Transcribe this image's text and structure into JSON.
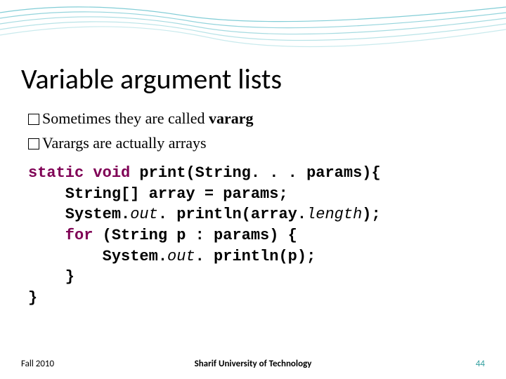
{
  "title": "Variable argument lists",
  "bullets": [
    {
      "prefix": "Sometimes they are called ",
      "bold": "vararg",
      "suffix": ""
    },
    {
      "prefix": "Varargs are actually arrays",
      "bold": "",
      "suffix": ""
    }
  ],
  "code": {
    "l1a": "static",
    "l1b": " void",
    "l1c": " print(String. . . params){",
    "l2": "    String[] array = params;",
    "l3a": "    System.",
    "l3b": "out",
    "l3c": ". println(array.",
    "l3d": "length",
    "l3e": ");",
    "l4a": "    for",
    "l4b": " (String p : params) {",
    "l5a": "        System.",
    "l5b": "out",
    "l5c": ". println(p);",
    "l6": "    }",
    "l7": "}"
  },
  "footer": {
    "left": "Fall 2010",
    "center": "Sharif University of Technology",
    "page": "44"
  }
}
